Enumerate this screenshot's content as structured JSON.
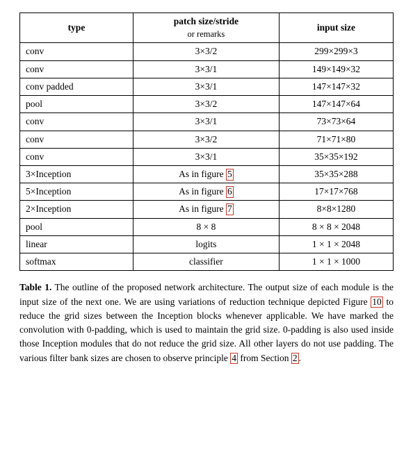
{
  "table": {
    "headers": [
      {
        "main": "type",
        "sub": ""
      },
      {
        "main": "patch size/stride",
        "sub": "or remarks"
      },
      {
        "main": "input size",
        "sub": ""
      }
    ],
    "rows": [
      {
        "type": "conv",
        "patch": "3×3/2",
        "input": "299×299×3"
      },
      {
        "type": "conv",
        "patch": "3×3/1",
        "input": "149×149×32"
      },
      {
        "type": "conv padded",
        "patch": "3×3/1",
        "input": "147×147×32"
      },
      {
        "type": "pool",
        "patch": "3×3/2",
        "input": "147×147×64"
      },
      {
        "type": "conv",
        "patch": "3×3/1",
        "input": "73×73×64"
      },
      {
        "type": "conv",
        "patch": "3×3/2",
        "input": "71×71×80"
      },
      {
        "type": "conv",
        "patch": "3×3/1",
        "input": "35×35×192"
      },
      {
        "type": "3×Inception",
        "patch": "As in figure 5",
        "input": "35×35×288",
        "highlight_patch": true
      },
      {
        "type": "5×Inception",
        "patch": "As in figure 6",
        "input": "17×17×768",
        "highlight_patch": true
      },
      {
        "type": "2×Inception",
        "patch": "As in figure 7",
        "input": "8×8×1280",
        "highlight_patch": true
      },
      {
        "type": "pool",
        "patch": "8 × 8",
        "input": "8 × 8 × 2048"
      },
      {
        "type": "linear",
        "patch": "logits",
        "input": "1 × 1 × 2048"
      },
      {
        "type": "softmax",
        "patch": "classifier",
        "input": "1 × 1 × 1000"
      }
    ]
  },
  "caption": {
    "label": "Table 1.",
    "text": " The outline of the proposed network architecture.  The output size of each module is the input size of the next one.  We are using variations of reduction technique depicted Figure ",
    "ref1": "10",
    "text2": " to reduce the grid sizes between the Inception blocks whenever applicable.  We have marked the convolution with 0-padding, which is used to maintain the grid size.  0-padding is also used inside those Inception modules that do not reduce the grid size.  All other layers do not use padding.  The various filter bank sizes are chosen to observe principle ",
    "ref2": "4",
    "text3": " from Section ",
    "ref3": "2",
    "text4": "."
  },
  "highlight_rows": [
    7
  ]
}
